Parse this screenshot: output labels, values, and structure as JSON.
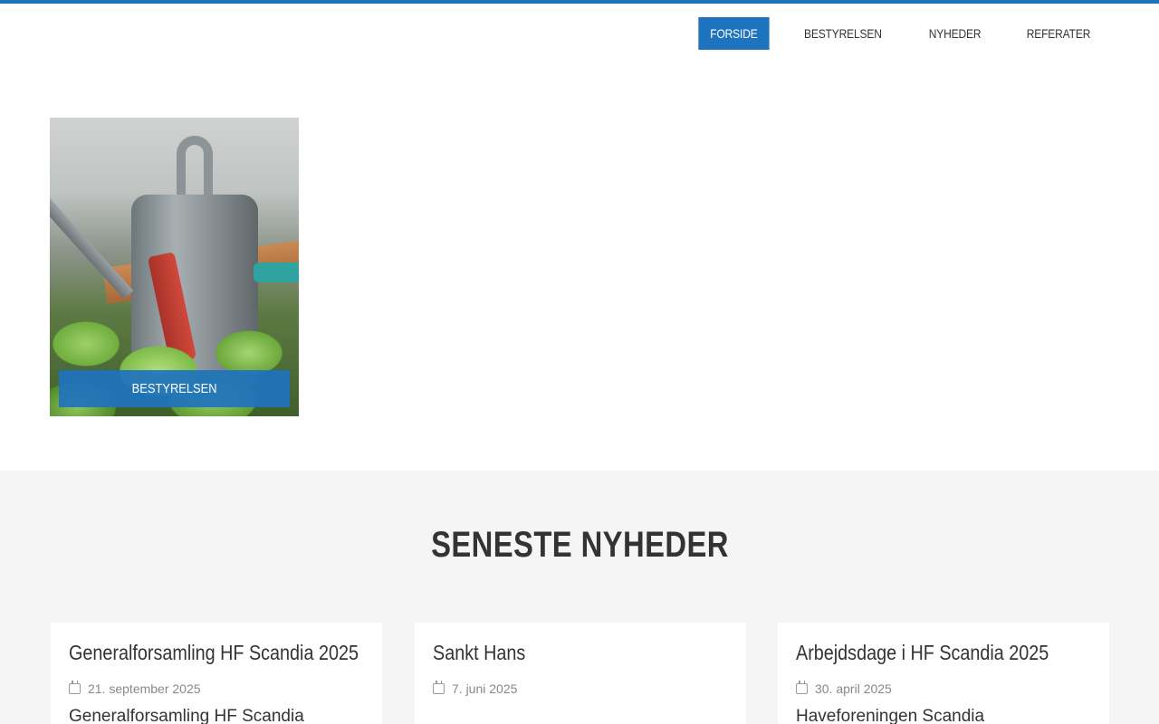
{
  "nav": {
    "items": [
      {
        "label": "FORSIDE",
        "active": true
      },
      {
        "label": "BESTYRELSEN",
        "active": false
      },
      {
        "label": "NYHEDER",
        "active": false
      },
      {
        "label": "REFERATER",
        "active": false
      }
    ]
  },
  "feature": {
    "label": "BESTYRELSEN"
  },
  "news": {
    "heading": "SENESTE NYHEDER",
    "cards": [
      {
        "title": "Generalforsamling HF Scandia 2025",
        "date": "21. september 2025",
        "excerpt": "Generalforsamling HF Scandia"
      },
      {
        "title": "Sankt Hans",
        "date": "7. juni 2025",
        "excerpt": ""
      },
      {
        "title": "Arbejdsdage i HF Scandia 2025",
        "date": "30. april 2025",
        "excerpt": "Haveforeningen Scandia"
      }
    ]
  },
  "colors": {
    "accent": "#1e73be",
    "section_bg": "#f5f5f5"
  }
}
